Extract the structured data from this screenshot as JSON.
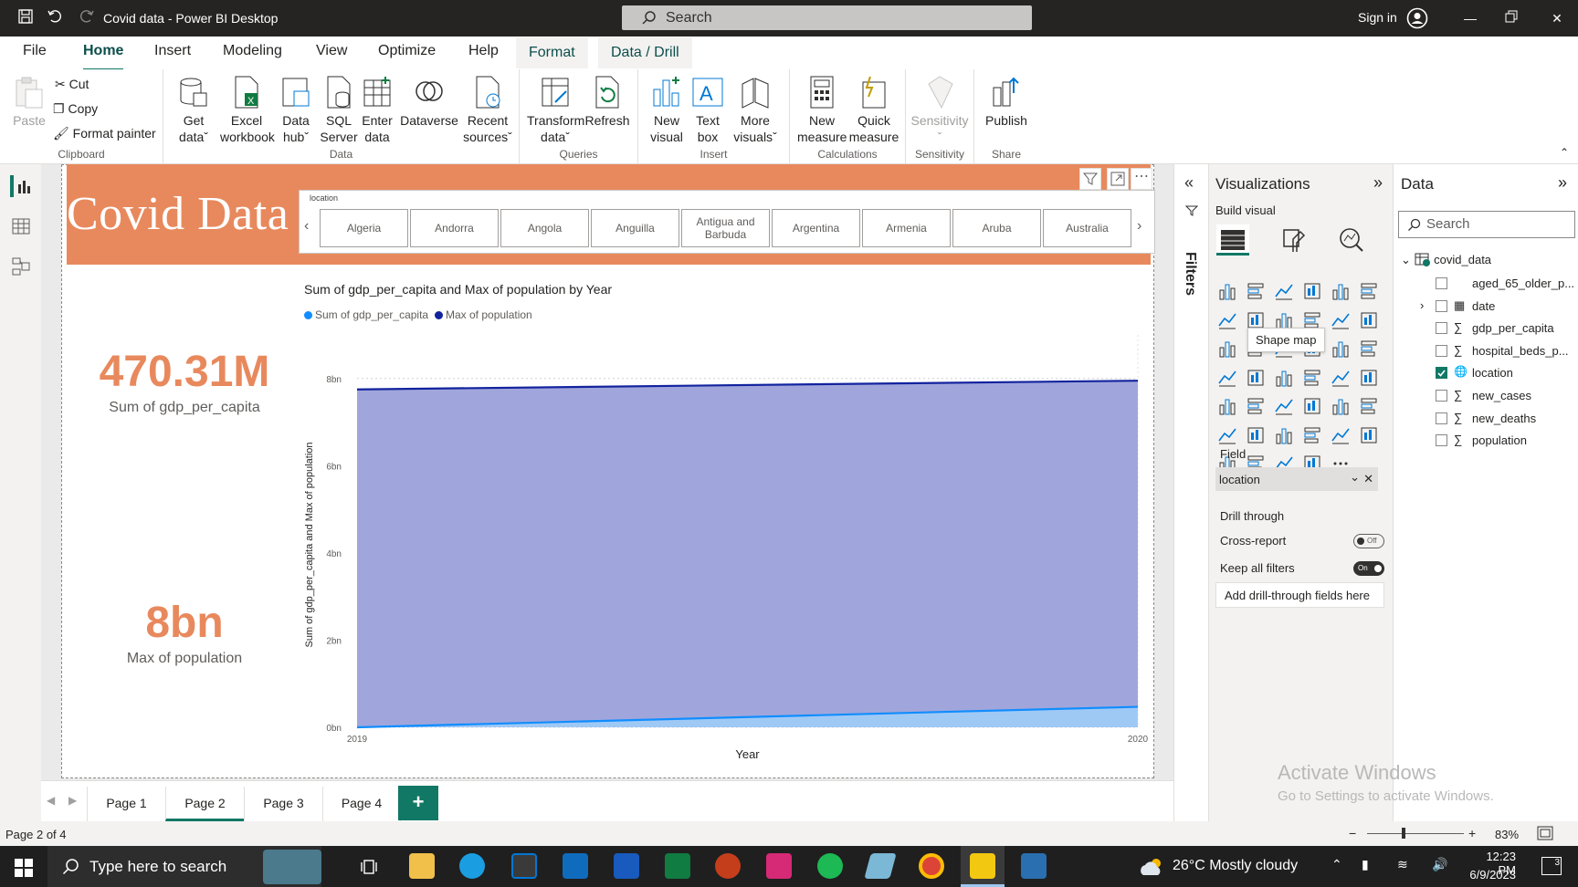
{
  "window": {
    "title": "Covid data - Power BI Desktop",
    "search": "Search",
    "sign_in": "Sign in"
  },
  "menu": [
    "File",
    "Home",
    "Insert",
    "Modeling",
    "View",
    "Optimize",
    "Help",
    "Format",
    "Data / Drill"
  ],
  "ribbon": {
    "clipboard": {
      "paste": "Paste",
      "cut": "Cut",
      "copy": "Copy",
      "format_painter": "Format painter",
      "label": "Clipboard"
    },
    "data": {
      "get_data": [
        "Get",
        "data"
      ],
      "excel": [
        "Excel",
        "workbook"
      ],
      "data_hub": [
        "Data",
        "hub"
      ],
      "sql": [
        "SQL",
        "Server"
      ],
      "enter": [
        "Enter",
        "data"
      ],
      "dataverse": "Dataverse",
      "recent": [
        "Recent",
        "sources"
      ],
      "label": "Data"
    },
    "queries": {
      "transform": [
        "Transform",
        "data"
      ],
      "refresh": "Refresh",
      "label": "Queries"
    },
    "insert": {
      "new_visual": [
        "New",
        "visual"
      ],
      "text_box": [
        "Text",
        "box"
      ],
      "more": [
        "More",
        "visuals"
      ],
      "label": "Insert"
    },
    "calc": {
      "new_measure": [
        "New",
        "measure"
      ],
      "quick": [
        "Quick",
        "measure"
      ],
      "label": "Calculations"
    },
    "sensitivity": {
      "btn": "Sensitivity",
      "label": "Sensitivity"
    },
    "share": {
      "publish": "Publish",
      "label": "Share"
    }
  },
  "report": {
    "banner_title": "Covid Data",
    "slicer": {
      "label": "location",
      "items": [
        "Algeria",
        "Andorra",
        "Angola",
        "Anguilla",
        "Antigua and Barbuda",
        "Argentina",
        "Armenia",
        "Aruba",
        "Australia"
      ]
    },
    "kpi1": {
      "value": "470.31M",
      "label": "Sum of gdp_per_capita"
    },
    "kpi2": {
      "value": "8bn",
      "label": "Max of population"
    },
    "chart_title": "Sum of gdp_per_capita and Max of population by Year",
    "legend": [
      "Sum of gdp_per_capita",
      "Max of population"
    ],
    "colors": {
      "banner": "#e8895d",
      "gdp": "#118dff",
      "population": "#12239e",
      "area": "#a0a6db"
    }
  },
  "chart_data": {
    "type": "area",
    "title": "Sum of gdp_per_capita and Max of population by Year",
    "xlabel": "Year",
    "ylabel": "Sum of gdp_per_capita and Max of population",
    "x": [
      "2019",
      "2020"
    ],
    "yticks": [
      "0bn",
      "2bn",
      "4bn",
      "6bn",
      "8bn"
    ],
    "ylim": [
      0,
      9
    ],
    "series": [
      {
        "name": "Sum of gdp_per_capita",
        "values": [
          0.0,
          0.47
        ]
      },
      {
        "name": "Max of population",
        "values": [
          7.75,
          7.95
        ]
      }
    ],
    "grid": true
  },
  "pages": [
    "Page 1",
    "Page 2",
    "Page 3",
    "Page 4"
  ],
  "active_page": "Page 2",
  "status": {
    "page": "Page 2 of 4",
    "zoom": "83%"
  },
  "filters_label": "Filters",
  "viz": {
    "title": "Visualizations",
    "build": "Build visual",
    "tooltip": "Shape map",
    "field_label": "Field",
    "field_value": "location",
    "drill": "Drill through",
    "cross": "Cross-report",
    "cross_state": "Off",
    "keep": "Keep all filters",
    "keep_state": "On",
    "add_drill": "Add drill-through fields here"
  },
  "data_pane": {
    "title": "Data",
    "search": "Search",
    "table": "covid_data",
    "fields": [
      "aged_65_older_p...",
      "date",
      "gdp_per_capita",
      "hospital_beds_p...",
      "location",
      "new_cases",
      "new_deaths",
      "population"
    ]
  },
  "activate": {
    "line1": "Activate Windows",
    "line2": "Go to Settings to activate Windows."
  },
  "taskbar": {
    "search": "Type here to search",
    "weather": "26°C  Mostly cloudy",
    "time": "12:23 PM",
    "date": "6/9/2023",
    "notif": "3"
  }
}
